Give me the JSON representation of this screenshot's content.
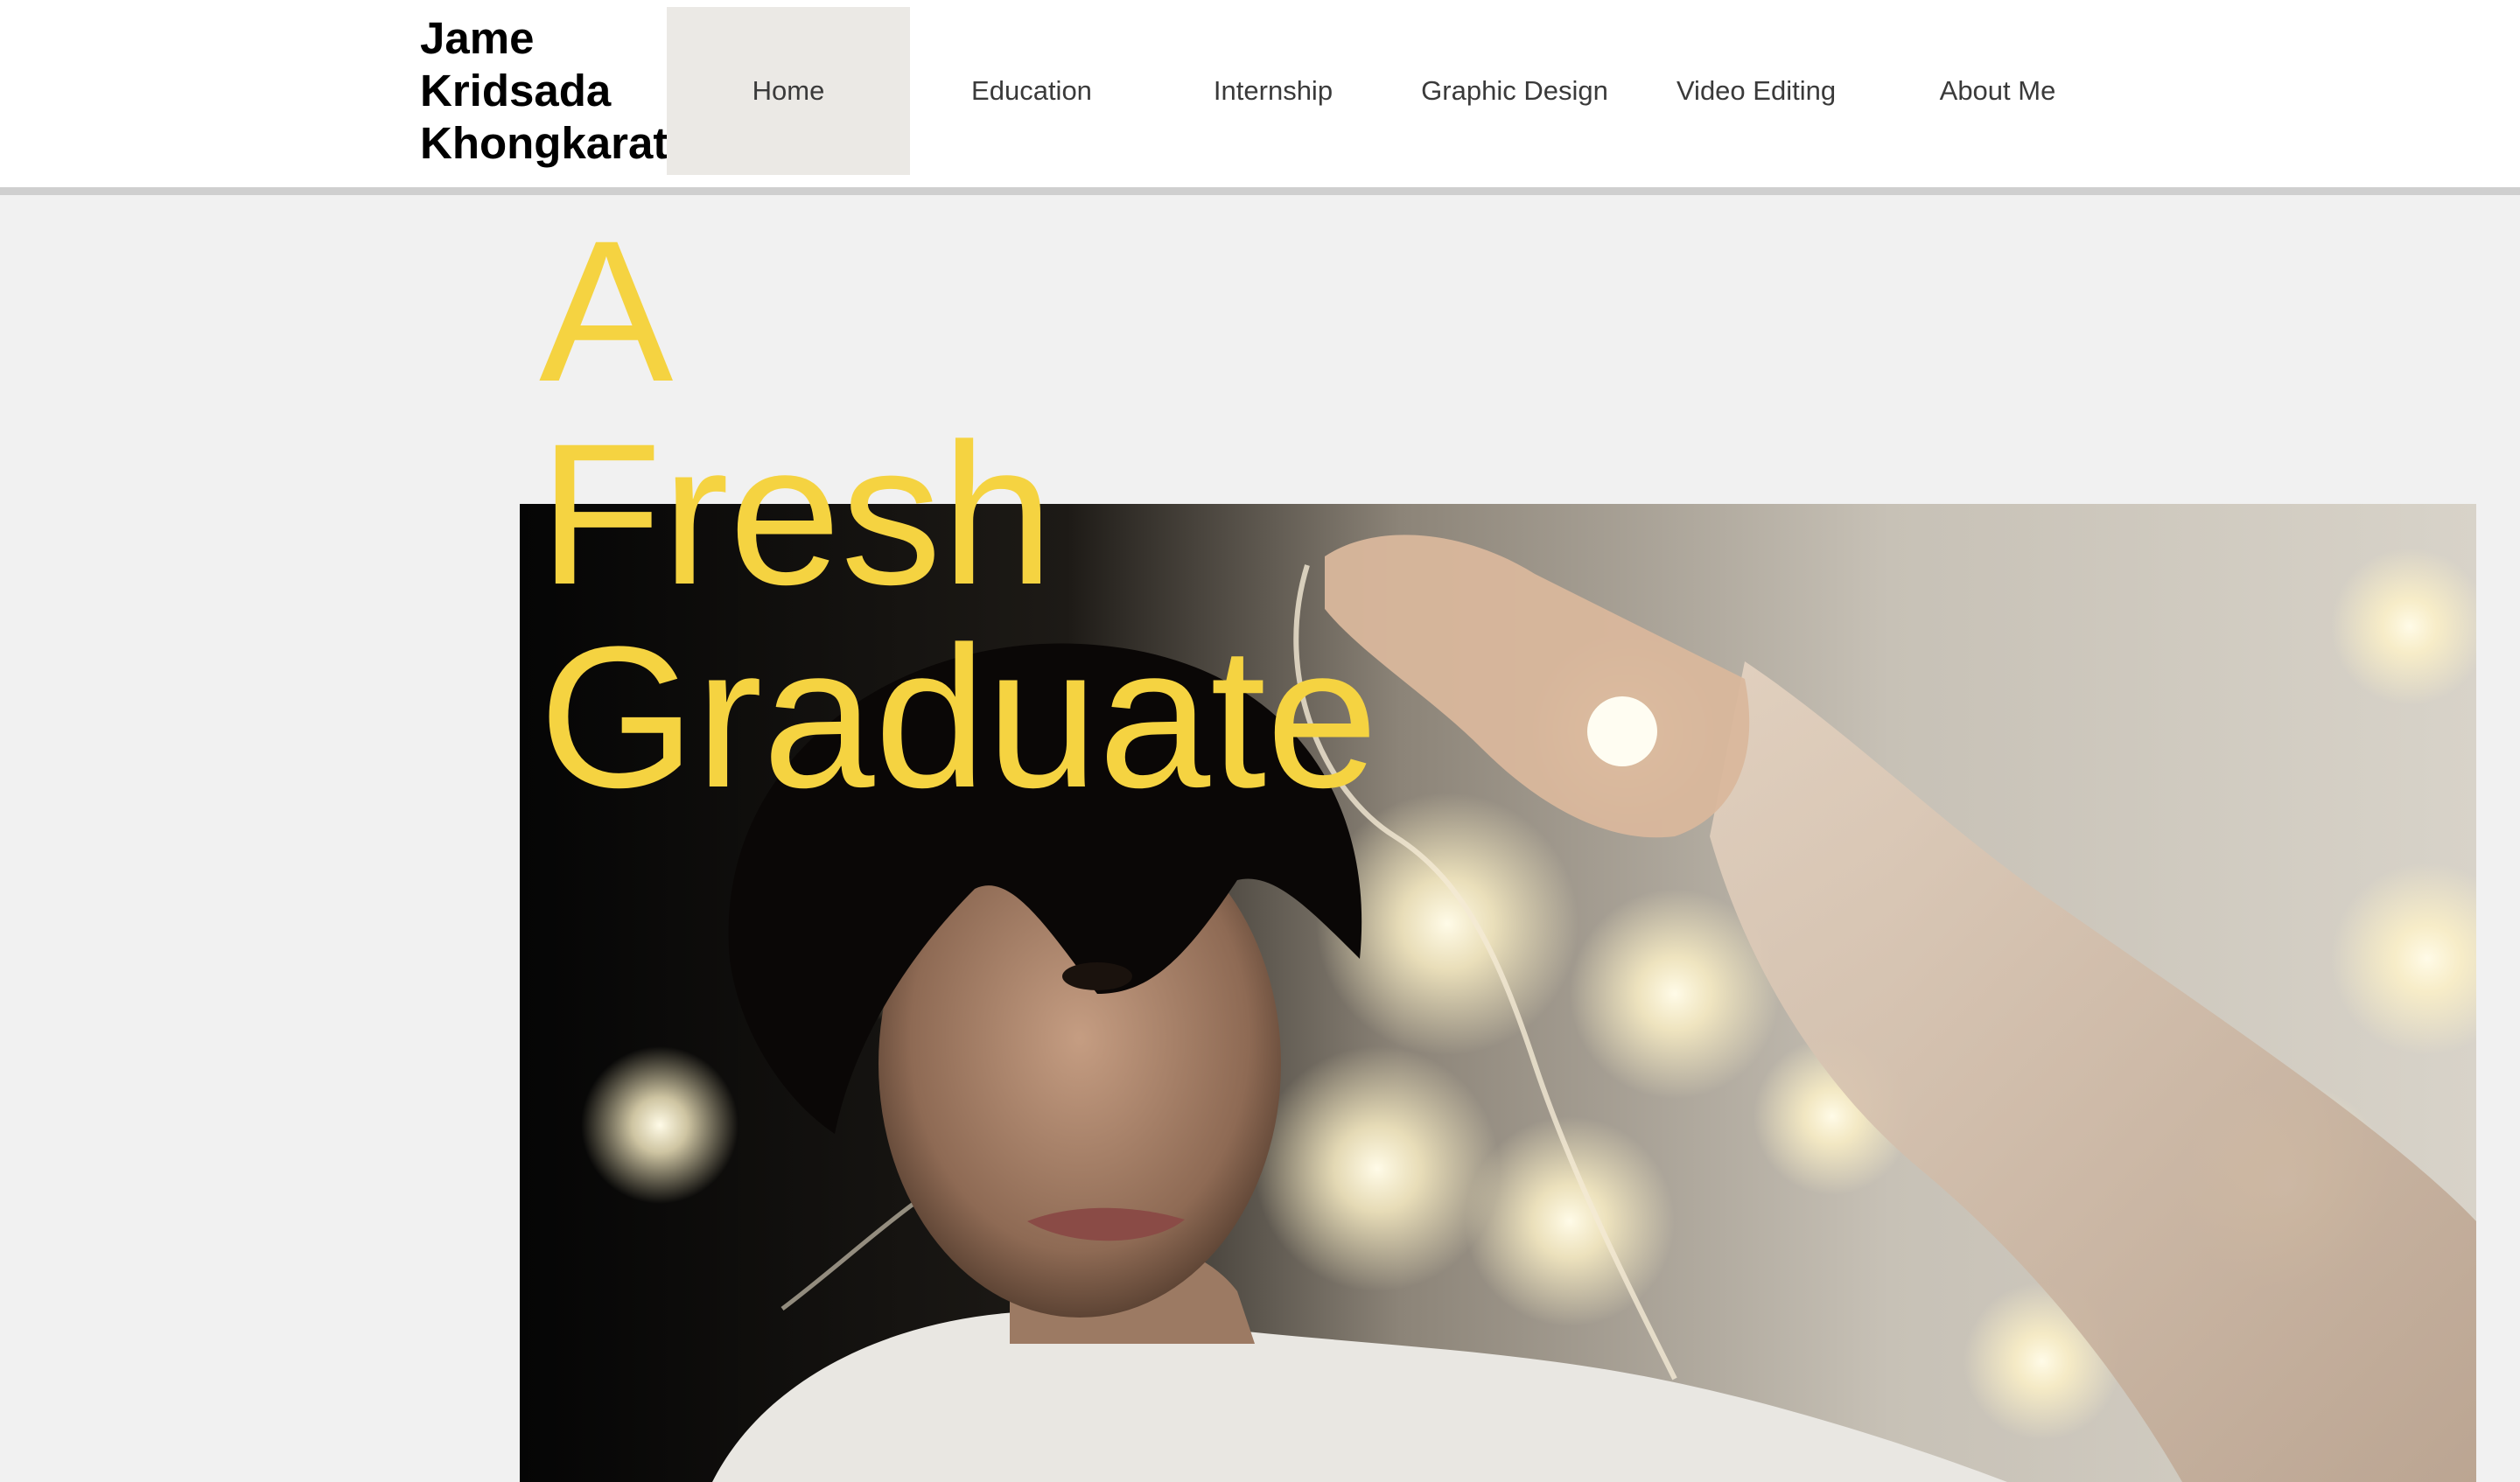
{
  "site": {
    "title_lines": [
      "Jame",
      "Kridsada",
      "Khongkarat"
    ]
  },
  "nav": {
    "items": [
      {
        "label": "Home",
        "active": true
      },
      {
        "label": "Education",
        "active": false
      },
      {
        "label": "Internship",
        "active": false
      },
      {
        "label": "Graphic Design",
        "active": false
      },
      {
        "label": "Video Editing",
        "active": false
      },
      {
        "label": "About Me",
        "active": false
      }
    ]
  },
  "hero": {
    "heading_lines": [
      "A",
      "Fresh",
      "Graduate"
    ],
    "photo": "portrait-with-fairy-lights"
  },
  "colors": {
    "page_background": "#f1f1f1",
    "header_background": "#ffffff",
    "active_nav_background": "#ebe9e5",
    "heading_accent": "#f5d341",
    "header_rule": "#cfcfcf"
  }
}
